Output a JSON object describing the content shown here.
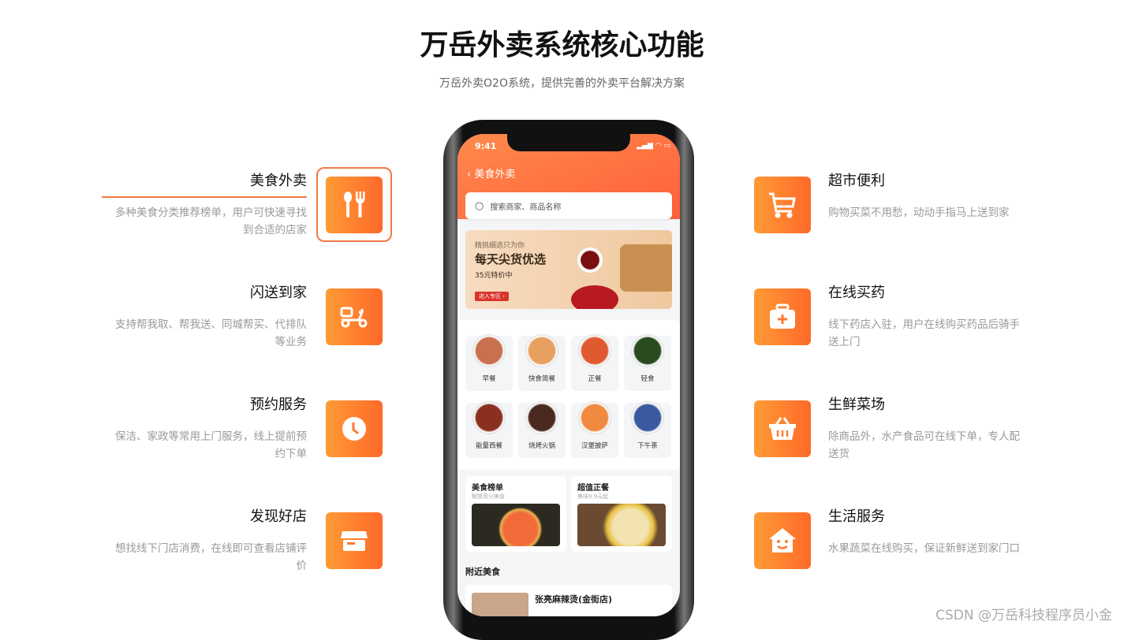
{
  "title": "万岳外卖系统核心功能",
  "subtitle": "万岳外卖O2O系统，提供完善的外卖平台解决方案",
  "left_features": [
    {
      "title": "美食外卖",
      "desc": "多种美食分类推荐榜单，用户可快速寻找到合适的店家",
      "icon": "fork-spoon-icon",
      "active": true
    },
    {
      "title": "闪送到家",
      "desc": "支持帮我取、帮我送、同城帮买、代排队等业务",
      "icon": "scooter-icon"
    },
    {
      "title": "预约服务",
      "desc": "保洁、家政等常用上门服务，线上提前预约下单",
      "icon": "clock-icon"
    },
    {
      "title": "发现好店",
      "desc": "想找线下门店消费，在线即可查看店铺评价",
      "icon": "store-icon"
    }
  ],
  "right_features": [
    {
      "title": "超市便利",
      "desc": "购物买菜不用愁，动动手指马上送到家",
      "icon": "cart-icon"
    },
    {
      "title": "在线买药",
      "desc": "线下药店入驻，用户在线购买药品后骑手送上门",
      "icon": "medkit-icon"
    },
    {
      "title": "生鲜菜场",
      "desc": "除商品外，水产食品可在线下单，专人配送货",
      "icon": "basket-icon"
    },
    {
      "title": "生活服务",
      "desc": "水果蔬菜在线购买，保证新鲜送到家门口",
      "icon": "house-smile-icon"
    }
  ],
  "phone": {
    "time": "9:41",
    "nav_title": "美食外卖",
    "search_placeholder": "搜索商家、商品名称",
    "banner": {
      "line1": "精挑细选只为你",
      "line2": "每天尖货优选",
      "line3": "35元特价中",
      "button": "进入专区 ›"
    },
    "categories": [
      "早餐",
      "快食简餐",
      "正餐",
      "轻食",
      "能量西餐",
      "烧烤火锅",
      "汉堡披萨",
      "下午茶"
    ],
    "cards": [
      {
        "title": "美食榜单",
        "sub": "解锁高分美食"
      },
      {
        "title": "超值正餐",
        "sub": "美味9.9元起"
      }
    ],
    "nearby_title": "附近美食",
    "shop_name": "张亮麻辣烫(金街店)"
  },
  "watermark": "CSDN @万岳科技程序员小金",
  "colors": {
    "accent": "#ff6a2a",
    "accent_light": "#ff9a35"
  }
}
